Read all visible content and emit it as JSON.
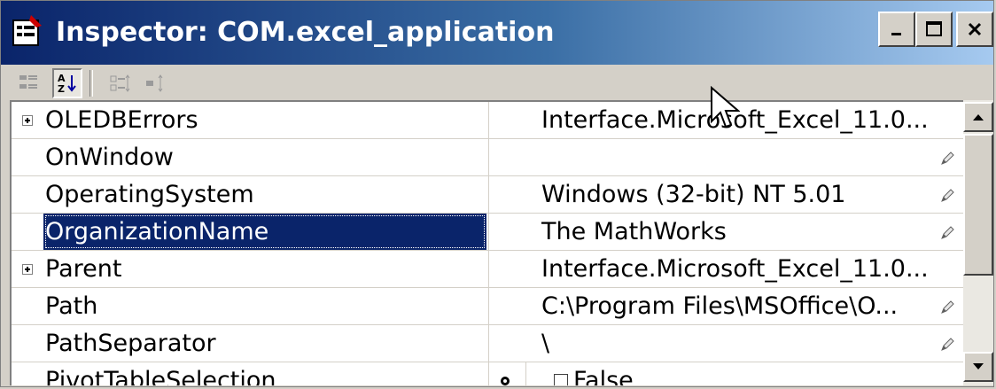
{
  "window": {
    "title": "Inspector:  COM.excel_application",
    "controls": {
      "minimize": "_",
      "maximize": "□",
      "close": "×"
    }
  },
  "toolbar": {
    "buttons": [
      {
        "icon": "categorized-icon",
        "pressed": false
      },
      {
        "icon": "sort-az-icon",
        "pressed": true
      },
      {
        "icon": "expand-all-icon",
        "pressed": false
      },
      {
        "icon": "collapse-all-icon",
        "pressed": false
      }
    ]
  },
  "properties": [
    {
      "name": "OLEDBErrors",
      "value": "Interface.Microsoft_Excel_11.0...",
      "expandable": true,
      "editable": false,
      "selected": false
    },
    {
      "name": "OnWindow",
      "value": "",
      "expandable": false,
      "editable": true,
      "selected": false
    },
    {
      "name": "OperatingSystem",
      "value": "Windows (32-bit) NT 5.01",
      "expandable": false,
      "editable": true,
      "selected": false
    },
    {
      "name": "OrganizationName",
      "value": "The MathWorks",
      "expandable": false,
      "editable": true,
      "selected": true
    },
    {
      "name": "Parent",
      "value": "Interface.Microsoft_Excel_11.0...",
      "expandable": true,
      "editable": false,
      "selected": false
    },
    {
      "name": "Path",
      "value": "C:\\Program Files\\MSOffice\\O...",
      "expandable": false,
      "editable": true,
      "selected": false
    },
    {
      "name": "PathSeparator",
      "value": "\\",
      "expandable": false,
      "editable": true,
      "selected": false
    },
    {
      "name": "PivotTableSelection",
      "value": "False",
      "expandable": false,
      "editable": false,
      "selected": false,
      "checkbox": true
    }
  ],
  "colors": {
    "selection": "#0a246a",
    "title_start": "#0a246a",
    "title_end": "#a6caf0"
  }
}
